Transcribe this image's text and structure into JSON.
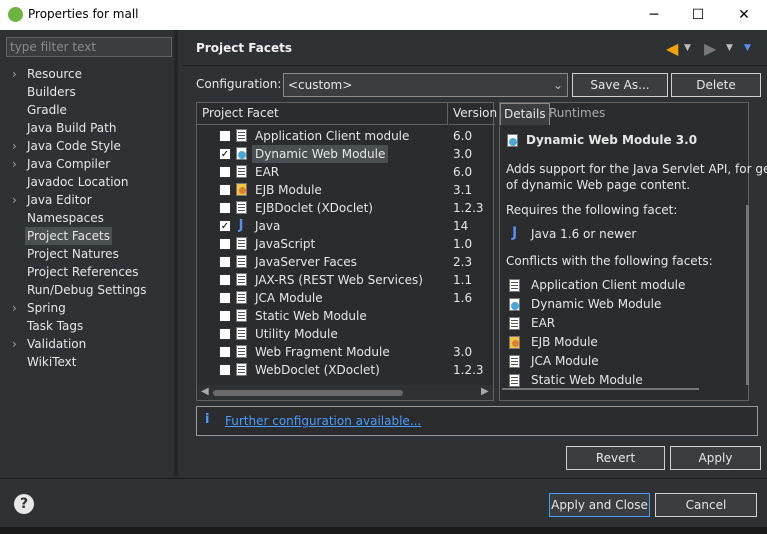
{
  "window": {
    "title": "Properties for mall",
    "minimize": "─",
    "maximize": "☐",
    "close": "✕"
  },
  "sidebar": {
    "filter_placeholder": "type filter text",
    "items": [
      {
        "label": "Resource",
        "expandable": true
      },
      {
        "label": "Builders",
        "expandable": false
      },
      {
        "label": "Gradle",
        "expandable": false
      },
      {
        "label": "Java Build Path",
        "expandable": false
      },
      {
        "label": "Java Code Style",
        "expandable": true
      },
      {
        "label": "Java Compiler",
        "expandable": true
      },
      {
        "label": "Javadoc Location",
        "expandable": false
      },
      {
        "label": "Java Editor",
        "expandable": true
      },
      {
        "label": "Namespaces",
        "expandable": false
      },
      {
        "label": "Project Facets",
        "expandable": false,
        "selected": true
      },
      {
        "label": "Project Natures",
        "expandable": false
      },
      {
        "label": "Project References",
        "expandable": false
      },
      {
        "label": "Run/Debug Settings",
        "expandable": false
      },
      {
        "label": "Spring",
        "expandable": true
      },
      {
        "label": "Task Tags",
        "expandable": false
      },
      {
        "label": "Validation",
        "expandable": true
      },
      {
        "label": "WikiText",
        "expandable": false
      }
    ]
  },
  "page": {
    "title": "Project Facets",
    "configuration_label": "Configuration:",
    "configuration_value": "<custom>",
    "save_as": "Save As...",
    "delete": "Delete"
  },
  "facets": {
    "col_facet": "Project Facet",
    "col_version": "Version",
    "rows": [
      {
        "label": "Application Client module",
        "version": "6.0",
        "checked": false,
        "icon": "document-icon"
      },
      {
        "label": "Dynamic Web Module",
        "version": "3.0",
        "checked": true,
        "icon": "dynamic-web-module-icon",
        "selected": true
      },
      {
        "label": "EAR",
        "version": "6.0",
        "checked": false,
        "icon": "document-icon"
      },
      {
        "label": "EJB Module",
        "version": "3.1",
        "checked": false,
        "icon": "ejb-icon"
      },
      {
        "label": "EJBDoclet (XDoclet)",
        "version": "1.2.3",
        "checked": false,
        "icon": "document-icon"
      },
      {
        "label": "Java",
        "version": "14",
        "checked": true,
        "icon": "java-icon"
      },
      {
        "label": "JavaScript",
        "version": "1.0",
        "checked": false,
        "icon": "document-icon"
      },
      {
        "label": "JavaServer Faces",
        "version": "2.3",
        "checked": false,
        "icon": "document-icon"
      },
      {
        "label": "JAX-RS (REST Web Services)",
        "version": "1.1",
        "checked": false,
        "icon": "document-icon"
      },
      {
        "label": "JCA Module",
        "version": "1.6",
        "checked": false,
        "icon": "document-icon"
      },
      {
        "label": "Static Web Module",
        "version": "",
        "checked": false,
        "icon": "document-icon"
      },
      {
        "label": "Utility Module",
        "version": "",
        "checked": false,
        "icon": "document-icon"
      },
      {
        "label": "Web Fragment Module",
        "version": "3.0",
        "checked": false,
        "icon": "document-icon"
      },
      {
        "label": "WebDoclet (XDoclet)",
        "version": "1.2.3",
        "checked": false,
        "icon": "document-icon"
      }
    ]
  },
  "details": {
    "tab_details": "Details",
    "tab_runtimes": "Runtimes",
    "title": "Dynamic Web Module 3.0",
    "desc1": "Adds support for the Java Servlet API, for ger",
    "desc2": "of dynamic Web page content.",
    "requires_label": "Requires the following facet:",
    "requires_item": "Java 1.6 or newer",
    "conflicts_label": "Conflicts with the following facets:",
    "conflicts": [
      {
        "label": "Application Client module",
        "icon": "document-icon"
      },
      {
        "label": "Dynamic Web Module",
        "icon": "dynamic-web-module-icon"
      },
      {
        "label": "EAR",
        "icon": "document-icon"
      },
      {
        "label": "EJB Module",
        "icon": "ejb-icon"
      },
      {
        "label": "JCA Module",
        "icon": "document-icon"
      },
      {
        "label": "Static Web Module",
        "icon": "document-icon"
      }
    ]
  },
  "info": {
    "link": "Further configuration available..."
  },
  "buttons": {
    "revert": "Revert",
    "apply": "Apply",
    "apply_close": "Apply and Close",
    "cancel": "Cancel",
    "help": "?"
  },
  "colors": {
    "accent_link": "#4a9cff",
    "back_arrow": "#f0a30a",
    "background": "#2f3234"
  }
}
